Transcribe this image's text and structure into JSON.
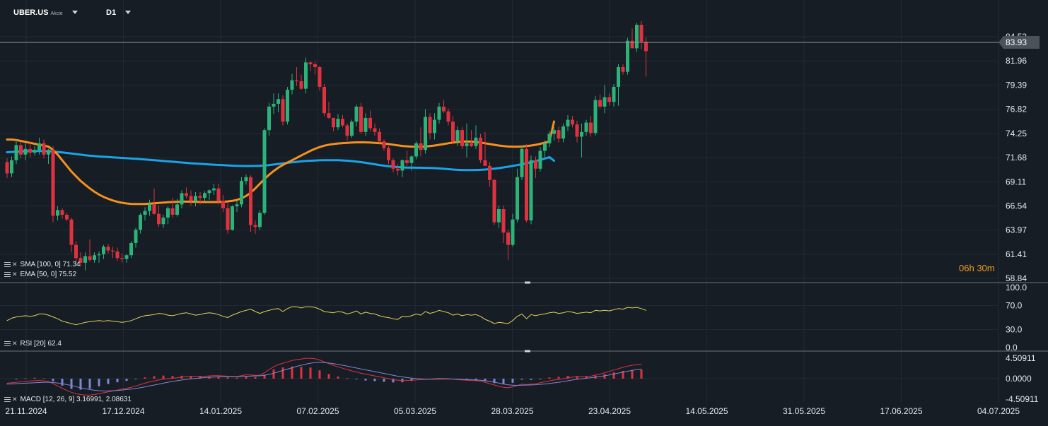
{
  "header": {
    "symbol": "UBER.US",
    "symbol_type": "Akcie",
    "timeframe": "D1"
  },
  "indicators": {
    "sma_label": "SMA [100, 0] 71.34",
    "ema_label": "EMA [50, 0] 75.52",
    "rsi_label": "RSI [20] 62.4",
    "macd_label": "MACD [12, 26, 9] 3.16991, 2.08631"
  },
  "countdown": {
    "hours": "06",
    "h": "h",
    "minutes": "30",
    "m": "m"
  },
  "colors": {
    "background": "#161d25",
    "grid": "#212a33",
    "bull": "#2bb37a",
    "bear": "#e0323e",
    "sma": "#1aa3e8",
    "ema": "#f5901e",
    "rsi": "#e4d35a",
    "macd_line": "#e0323e",
    "signal_line": "#7f86d6",
    "hist_pos": "#e0323e",
    "hist_neg": "#7f86d6",
    "price_line": "#8d969e",
    "price_tag_bg": "#4a535b"
  },
  "chart_data": {
    "type": "candlestick",
    "symbol": "UBER.US",
    "timeframe": "D1",
    "current_price": 83.93,
    "price_tag": "83.93",
    "price_axis_ticks": [
      "84.53",
      "81.96",
      "79.39",
      "76.82",
      "74.25",
      "71.68",
      "69.11",
      "66.54",
      "63.97",
      "61.41",
      "58.84"
    ],
    "ylim": [
      58.84,
      84.53
    ],
    "date_axis_ticks": [
      "21.11.2024",
      "17.12.2024",
      "14.01.2025",
      "07.02.2025",
      "05.03.2025",
      "28.03.2025",
      "23.04.2025",
      "14.05.2025",
      "31.05.2025",
      "17.06.2025",
      "04.07.2025"
    ],
    "ohlc": [
      [
        71.2,
        71.6,
        69.5,
        70.0
      ],
      [
        70.0,
        71.8,
        69.6,
        71.4
      ],
      [
        71.4,
        73.6,
        71.0,
        73.0
      ],
      [
        73.0,
        73.4,
        71.6,
        72.0
      ],
      [
        72.0,
        73.2,
        71.4,
        72.6
      ],
      [
        72.6,
        73.4,
        71.7,
        72.2
      ],
      [
        72.2,
        72.9,
        71.9,
        72.5
      ],
      [
        72.5,
        73.8,
        72.0,
        73.2
      ],
      [
        73.2,
        73.6,
        71.6,
        72.0
      ],
      [
        72.0,
        72.6,
        71.0,
        72.5
      ],
      [
        72.5,
        72.9,
        64.8,
        65.5
      ],
      [
        65.5,
        66.5,
        65.0,
        66.1
      ],
      [
        66.1,
        66.3,
        65.2,
        65.6
      ],
      [
        65.6,
        65.8,
        64.9,
        65.1
      ],
      [
        65.1,
        65.3,
        61.6,
        62.4
      ],
      [
        62.4,
        62.8,
        60.4,
        61.0
      ],
      [
        61.0,
        61.6,
        60.1,
        60.5
      ],
      [
        60.5,
        61.6,
        59.7,
        61.2
      ],
      [
        61.2,
        63.0,
        60.6,
        60.8
      ],
      [
        60.8,
        61.6,
        60.5,
        61.3
      ],
      [
        61.3,
        61.7,
        60.5,
        61.4
      ],
      [
        61.4,
        62.4,
        60.9,
        62.2
      ],
      [
        62.2,
        62.5,
        61.5,
        61.8
      ],
      [
        61.8,
        62.2,
        61.0,
        61.7
      ],
      [
        61.7,
        62.1,
        60.7,
        61.0
      ],
      [
        61.0,
        61.5,
        60.5,
        60.9
      ],
      [
        60.9,
        61.4,
        60.5,
        61.3
      ],
      [
        61.3,
        62.8,
        61.0,
        62.6
      ],
      [
        62.6,
        64.2,
        62.1,
        64.0
      ],
      [
        64.0,
        65.8,
        63.6,
        65.6
      ],
      [
        65.6,
        66.4,
        65.0,
        66.0
      ],
      [
        66.0,
        67.2,
        65.5,
        66.7
      ],
      [
        66.7,
        68.4,
        65.6,
        65.7
      ],
      [
        65.7,
        66.6,
        64.3,
        64.6
      ],
      [
        64.6,
        65.6,
        64.2,
        65.3
      ],
      [
        65.3,
        66.5,
        64.6,
        66.3
      ],
      [
        66.3,
        67.4,
        65.3,
        65.6
      ],
      [
        65.6,
        67.3,
        65.4,
        66.7
      ],
      [
        66.7,
        68.2,
        66.3,
        67.9
      ],
      [
        67.9,
        68.5,
        67.3,
        67.6
      ],
      [
        67.6,
        68.2,
        66.6,
        67.1
      ],
      [
        67.1,
        68.0,
        66.5,
        67.6
      ],
      [
        67.6,
        68.0,
        66.7,
        67.4
      ],
      [
        67.4,
        68.1,
        67.0,
        67.9
      ],
      [
        67.9,
        68.3,
        67.2,
        68.2
      ],
      [
        68.2,
        68.9,
        67.7,
        68.4
      ],
      [
        68.4,
        68.9,
        66.7,
        67.1
      ],
      [
        67.1,
        67.7,
        65.9,
        66.3
      ],
      [
        66.3,
        66.8,
        63.6,
        64.0
      ],
      [
        64.0,
        66.6,
        63.9,
        66.5
      ],
      [
        66.5,
        67.1,
        65.9,
        66.7
      ],
      [
        66.7,
        69.6,
        66.4,
        69.2
      ],
      [
        69.2,
        69.9,
        68.8,
        69.6
      ],
      [
        69.6,
        69.8,
        63.8,
        64.5
      ],
      [
        64.5,
        65.0,
        63.6,
        64.3
      ],
      [
        64.3,
        66.1,
        64.0,
        65.8
      ],
      [
        65.8,
        74.8,
        65.6,
        74.6
      ],
      [
        74.6,
        77.5,
        74.0,
        77.1
      ],
      [
        77.1,
        78.5,
        76.3,
        77.4
      ],
      [
        77.4,
        78.5,
        76.5,
        77.9
      ],
      [
        77.9,
        78.3,
        75.1,
        75.5
      ],
      [
        75.5,
        79.2,
        75.2,
        78.9
      ],
      [
        78.9,
        80.6,
        78.4,
        79.9
      ],
      [
        79.9,
        81.3,
        79.3,
        79.8
      ],
      [
        79.8,
        80.5,
        78.9,
        79.0
      ],
      [
        79.0,
        82.3,
        78.5,
        81.8
      ],
      [
        81.8,
        81.9,
        80.9,
        81.6
      ],
      [
        81.6,
        81.9,
        80.5,
        81.3
      ],
      [
        81.3,
        81.4,
        78.8,
        79.2
      ],
      [
        79.2,
        79.5,
        76.1,
        76.4
      ],
      [
        76.4,
        77.6,
        75.8,
        75.9
      ],
      [
        75.9,
        75.9,
        74.5,
        74.9
      ],
      [
        74.9,
        76.3,
        74.6,
        75.8
      ],
      [
        75.8,
        76.2,
        74.9,
        75.1
      ],
      [
        75.1,
        75.3,
        73.5,
        74.0
      ],
      [
        74.0,
        75.7,
        73.8,
        75.5
      ],
      [
        75.5,
        77.3,
        75.0,
        77.1
      ],
      [
        77.1,
        77.5,
        74.2,
        74.4
      ],
      [
        74.4,
        76.4,
        74.0,
        75.9
      ],
      [
        75.9,
        76.7,
        74.5,
        74.8
      ],
      [
        74.8,
        75.3,
        74.0,
        74.4
      ],
      [
        74.4,
        74.8,
        73.2,
        73.4
      ],
      [
        73.4,
        73.6,
        72.4,
        72.7
      ],
      [
        72.7,
        72.9,
        71.0,
        71.4
      ],
      [
        71.4,
        71.6,
        70.1,
        70.5
      ],
      [
        70.5,
        71.0,
        69.8,
        70.3
      ],
      [
        70.3,
        71.5,
        69.6,
        71.4
      ],
      [
        71.4,
        72.4,
        70.8,
        71.1
      ],
      [
        71.1,
        71.9,
        70.3,
        71.8
      ],
      [
        71.8,
        73.4,
        71.5,
        73.2
      ],
      [
        73.2,
        74.9,
        71.8,
        72.5
      ],
      [
        72.5,
        76.8,
        72.1,
        76.0
      ],
      [
        76.0,
        76.4,
        73.6,
        74.3
      ],
      [
        74.3,
        76.4,
        73.6,
        75.7
      ],
      [
        75.7,
        77.5,
        75.3,
        77.1
      ],
      [
        77.1,
        77.8,
        76.4,
        76.6
      ],
      [
        76.6,
        76.9,
        75.1,
        75.5
      ],
      [
        75.5,
        76.1,
        73.1,
        73.4
      ],
      [
        73.4,
        75.0,
        72.9,
        74.6
      ],
      [
        74.6,
        74.9,
        72.6,
        72.9
      ],
      [
        72.9,
        75.3,
        71.7,
        73.2
      ],
      [
        73.2,
        74.6,
        72.8,
        72.9
      ],
      [
        72.9,
        75.1,
        72.6,
        73.8
      ],
      [
        73.8,
        74.2,
        71.1,
        71.4
      ],
      [
        71.4,
        74.4,
        71.1,
        70.8
      ],
      [
        70.8,
        71.2,
        68.6,
        69.3
      ],
      [
        69.3,
        69.4,
        64.5,
        64.8
      ],
      [
        64.8,
        66.6,
        64.2,
        66.2
      ],
      [
        66.2,
        66.6,
        62.6,
        63.7
      ],
      [
        63.7,
        64.0,
        60.8,
        62.4
      ],
      [
        62.4,
        65.7,
        62.2,
        65.1
      ],
      [
        65.1,
        70.5,
        64.8,
        69.6
      ],
      [
        69.6,
        72.9,
        69.3,
        72.6
      ],
      [
        72.6,
        73.1,
        64.8,
        65.0
      ],
      [
        65.0,
        71.9,
        64.6,
        71.4
      ],
      [
        71.4,
        71.8,
        69.5,
        70.5
      ],
      [
        70.5,
        72.8,
        70.2,
        72.4
      ],
      [
        72.4,
        73.5,
        71.7,
        73.2
      ],
      [
        73.2,
        74.5,
        72.8,
        74.2
      ],
      [
        74.2,
        74.9,
        73.5,
        74.6
      ],
      [
        74.6,
        75.0,
        73.3,
        73.7
      ],
      [
        73.7,
        75.3,
        73.3,
        75.0
      ],
      [
        75.0,
        76.2,
        74.5,
        75.7
      ],
      [
        75.7,
        76.1,
        74.9,
        75.2
      ],
      [
        75.2,
        75.6,
        73.3,
        73.9
      ],
      [
        73.9,
        75.3,
        71.7,
        74.4
      ],
      [
        74.4,
        75.7,
        74.0,
        75.4
      ],
      [
        75.4,
        76.1,
        73.9,
        74.3
      ],
      [
        74.3,
        78.2,
        74.0,
        77.8
      ],
      [
        77.8,
        78.4,
        76.9,
        77.1
      ],
      [
        77.1,
        79.4,
        76.4,
        78.1
      ],
      [
        78.1,
        78.5,
        77.2,
        77.6
      ],
      [
        77.6,
        79.5,
        77.1,
        79.2
      ],
      [
        79.2,
        81.6,
        77.2,
        81.3
      ],
      [
        81.3,
        81.6,
        80.5,
        80.8
      ],
      [
        80.8,
        84.4,
        80.5,
        84.1
      ],
      [
        84.1,
        85.4,
        83.6,
        83.3
      ],
      [
        83.3,
        86.0,
        82.9,
        85.8
      ],
      [
        85.8,
        86.2,
        83.2,
        84.0
      ],
      [
        84.0,
        84.5,
        80.3,
        83.0
      ]
    ],
    "sma_100": [
      72.25,
      72.28,
      72.31,
      72.33,
      72.35,
      72.37,
      72.38,
      72.38,
      72.37,
      72.35,
      72.32,
      72.28,
      72.23,
      72.17,
      72.11,
      72.05,
      71.99,
      71.93,
      71.88,
      71.84,
      71.8,
      71.77,
      71.74,
      71.71,
      71.68,
      71.65,
      71.62,
      71.58,
      71.55,
      71.52,
      71.48,
      71.44,
      71.4,
      71.36,
      71.32,
      71.28,
      71.24,
      71.2,
      71.16,
      71.12,
      71.08,
      71.05,
      71.02,
      70.99,
      70.96,
      70.93,
      70.9,
      70.87,
      70.85,
      70.82,
      70.8,
      70.79,
      70.78,
      70.78,
      70.79,
      70.81,
      70.84,
      70.88,
      70.94,
      71.0,
      71.06,
      71.12,
      71.18,
      71.23,
      71.28,
      71.32,
      71.35,
      71.37,
      71.39,
      71.4,
      71.41,
      71.41,
      71.4,
      71.38,
      71.35,
      71.31,
      71.26,
      71.2,
      71.13,
      71.05,
      70.97,
      70.89,
      70.82,
      70.76,
      70.71,
      70.67,
      70.64,
      70.62,
      70.61,
      70.6,
      70.6,
      70.59,
      70.58,
      70.56,
      70.53,
      70.49,
      70.45,
      70.41,
      70.38,
      70.36,
      70.35,
      70.35,
      70.36,
      70.38,
      70.41,
      70.45,
      70.5,
      70.56,
      70.63,
      70.71,
      70.79,
      70.88,
      70.98,
      71.08,
      71.19,
      71.31,
      71.44,
      71.58,
      71.73,
      71.34
    ],
    "ema_50": [
      73.6,
      73.6,
      73.55,
      73.45,
      73.35,
      73.25,
      73.15,
      73.05,
      72.95,
      72.85,
      72.5,
      72.0,
      71.4,
      70.8,
      70.2,
      69.7,
      69.2,
      68.8,
      68.4,
      68.05,
      67.75,
      67.5,
      67.3,
      67.12,
      66.98,
      66.88,
      66.8,
      66.76,
      66.74,
      66.74,
      66.75,
      66.78,
      66.82,
      66.86,
      66.9,
      66.93,
      66.96,
      66.98,
      67.0,
      67.0,
      66.99,
      66.98,
      66.96,
      66.95,
      66.95,
      66.95,
      66.96,
      66.98,
      67.02,
      67.08,
      67.18,
      67.35,
      67.6,
      67.95,
      68.4,
      68.9,
      69.4,
      69.85,
      70.25,
      70.6,
      70.9,
      71.15,
      71.4,
      71.65,
      71.9,
      72.15,
      72.4,
      72.62,
      72.8,
      72.95,
      73.05,
      73.12,
      73.18,
      73.22,
      73.25,
      73.28,
      73.3,
      73.31,
      73.3,
      73.28,
      73.25,
      73.22,
      73.18,
      73.12,
      73.05,
      72.98,
      72.92,
      72.88,
      72.85,
      72.84,
      72.84,
      72.86,
      72.9,
      72.96,
      73.04,
      73.12,
      73.2,
      73.28,
      73.34,
      73.38,
      73.4,
      73.38,
      73.34,
      73.28,
      73.2,
      73.12,
      73.04,
      72.96,
      72.9,
      72.86,
      72.84,
      72.84,
      72.86,
      72.9,
      72.96,
      73.04,
      73.14,
      73.26,
      73.4,
      75.52
    ],
    "rsi_ylim": [
      0,
      100
    ],
    "rsi_ticks": [
      "100.0",
      "70.0",
      "30.0",
      "0.0"
    ],
    "rsi": [
      45,
      49,
      51,
      52,
      53,
      52,
      53,
      56,
      56,
      54,
      51,
      48,
      44,
      42,
      40,
      38,
      40,
      42,
      43,
      44,
      45,
      44,
      45,
      44,
      43,
      42,
      43,
      45,
      48,
      51,
      53,
      54,
      55,
      57,
      56,
      54,
      53,
      55,
      57,
      58,
      56,
      54,
      55,
      57,
      58,
      57,
      55,
      52,
      50,
      54,
      57,
      60,
      62,
      64,
      60,
      57,
      60,
      62,
      64,
      65,
      60,
      65,
      68,
      68,
      66,
      68,
      68,
      67,
      64,
      60,
      59,
      58,
      60,
      59,
      56,
      58,
      61,
      56,
      59,
      57,
      56,
      53,
      51,
      50,
      48,
      47,
      52,
      51,
      53,
      56,
      54,
      60,
      57,
      59,
      62,
      60,
      58,
      54,
      56,
      53,
      55,
      54,
      55,
      52,
      47,
      44,
      40,
      42,
      41,
      40,
      45,
      52,
      56,
      48,
      55,
      53,
      55,
      56,
      58,
      59,
      57,
      58,
      60,
      59,
      57,
      58,
      59,
      58,
      62,
      61,
      62,
      61,
      63,
      65,
      64,
      67,
      66,
      67,
      65,
      62
    ],
    "macd_ylim": [
      -4.50911,
      4.50911
    ],
    "macd_ticks": [
      "4.50911",
      "0.0000",
      "-4.50911"
    ],
    "macd": [
      -1.0,
      -0.9,
      -0.8,
      -0.7,
      -0.6,
      -0.5,
      -0.45,
      -0.4,
      -0.5,
      -0.6,
      -1.1,
      -1.6,
      -2.1,
      -2.6,
      -3.0,
      -3.3,
      -3.5,
      -3.6,
      -3.6,
      -3.5,
      -3.3,
      -3.1,
      -2.9,
      -2.7,
      -2.5,
      -2.3,
      -2.1,
      -1.9,
      -1.6,
      -1.3,
      -1.0,
      -0.7,
      -0.5,
      -0.3,
      -0.1,
      0.0,
      0.1,
      0.2,
      0.35,
      0.45,
      0.5,
      0.55,
      0.55,
      0.55,
      0.6,
      0.65,
      0.65,
      0.6,
      0.55,
      0.5,
      0.5,
      0.65,
      0.85,
      0.8,
      0.75,
      0.75,
      1.3,
      2.0,
      2.6,
      3.1,
      3.4,
      3.7,
      4.0,
      4.2,
      4.3,
      4.5,
      4.5,
      4.4,
      4.1,
      3.7,
      3.3,
      2.9,
      2.6,
      2.3,
      2.0,
      1.7,
      1.5,
      1.2,
      1.0,
      0.8,
      0.6,
      0.4,
      0.2,
      0.0,
      -0.2,
      -0.35,
      -0.4,
      -0.4,
      -0.35,
      -0.3,
      -0.2,
      -0.15,
      -0.1,
      0.0,
      0.05,
      0.05,
      0.0,
      -0.1,
      -0.2,
      -0.3,
      -0.35,
      -0.4,
      -0.45,
      -0.55,
      -0.8,
      -1.1,
      -1.4,
      -1.7,
      -1.9,
      -2.0,
      -1.8,
      -1.5,
      -1.2,
      -1.3,
      -1.2,
      -1.1,
      -0.9,
      -0.7,
      -0.5,
      -0.3,
      -0.2,
      0.0,
      0.2,
      0.35,
      0.4,
      0.45,
      0.5,
      0.55,
      0.8,
      1.0,
      1.3,
      1.6,
      1.9,
      2.2,
      2.5,
      2.75,
      2.95,
      3.1,
      3.17
    ],
    "signal": [
      -1.2,
      -1.15,
      -1.1,
      -1.05,
      -1.0,
      -0.95,
      -0.9,
      -0.85,
      -0.8,
      -0.8,
      -0.85,
      -0.95,
      -1.1,
      -1.3,
      -1.5,
      -1.75,
      -2.0,
      -2.2,
      -2.4,
      -2.55,
      -2.65,
      -2.7,
      -2.7,
      -2.65,
      -2.6,
      -2.5,
      -2.4,
      -2.3,
      -2.15,
      -2.0,
      -1.8,
      -1.6,
      -1.4,
      -1.2,
      -1.0,
      -0.8,
      -0.6,
      -0.45,
      -0.3,
      -0.15,
      -0.05,
      0.05,
      0.15,
      0.25,
      0.3,
      0.35,
      0.4,
      0.45,
      0.45,
      0.45,
      0.45,
      0.48,
      0.52,
      0.56,
      0.6,
      0.62,
      0.75,
      0.95,
      1.2,
      1.5,
      1.8,
      2.1,
      2.4,
      2.7,
      2.95,
      3.2,
      3.4,
      3.55,
      3.6,
      3.55,
      3.45,
      3.3,
      3.15,
      2.95,
      2.75,
      2.55,
      2.35,
      2.15,
      1.95,
      1.75,
      1.55,
      1.35,
      1.15,
      0.95,
      0.75,
      0.55,
      0.4,
      0.25,
      0.12,
      0.02,
      -0.05,
      -0.1,
      -0.12,
      -0.12,
      -0.1,
      -0.08,
      -0.08,
      -0.1,
      -0.12,
      -0.16,
      -0.2,
      -0.25,
      -0.3,
      -0.36,
      -0.45,
      -0.6,
      -0.78,
      -0.98,
      -1.18,
      -1.36,
      -1.45,
      -1.48,
      -1.45,
      -1.42,
      -1.38,
      -1.33,
      -1.26,
      -1.17,
      -1.06,
      -0.93,
      -0.8,
      -0.64,
      -0.47,
      -0.3,
      -0.15,
      -0.02,
      0.1,
      0.2,
      0.32,
      0.46,
      0.63,
      0.82,
      1.02,
      1.23,
      1.44,
      1.64,
      1.84,
      2.0,
      2.09
    ]
  }
}
